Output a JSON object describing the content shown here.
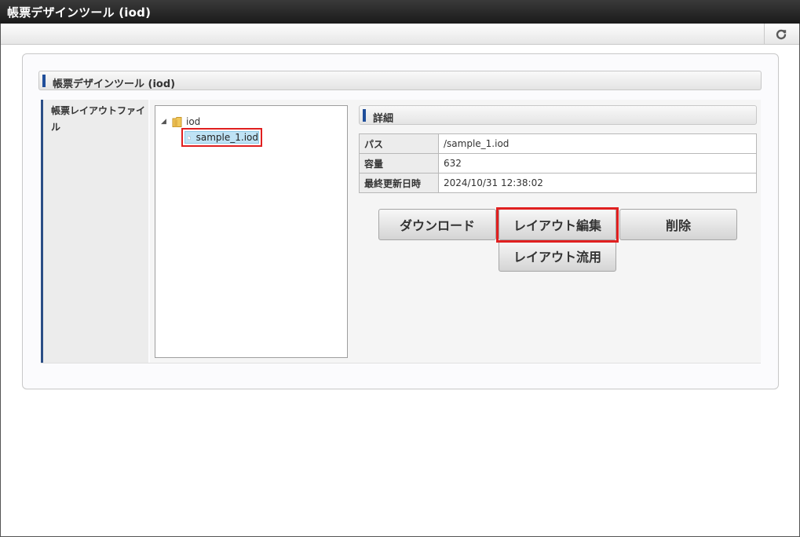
{
  "window": {
    "title": "帳票デザインツール (iod)"
  },
  "toolbar": {
    "refresh_icon": "refresh-icon"
  },
  "panel": {
    "title": "帳票デザインツール (iod)"
  },
  "form": {
    "label": "帳票レイアウトファイル",
    "tree": {
      "root": {
        "label": "iod",
        "icon": "folder-icon",
        "expanded": true
      },
      "children": [
        {
          "label": "sample_1.iod",
          "icon": "file-icon",
          "selected": true
        }
      ]
    },
    "detail": {
      "title": "詳細",
      "rows": [
        {
          "key": "パス",
          "value": "/sample_1.iod"
        },
        {
          "key": "容量",
          "value": "632"
        },
        {
          "key": "最終更新日時",
          "value": "2024/10/31 12:38:02"
        }
      ]
    },
    "buttons": {
      "download": "ダウンロード",
      "edit_layout": "レイアウト編集",
      "delete": "削除",
      "reuse_layout": "レイアウト流用"
    }
  },
  "colors": {
    "accent_bar": "#1f4e9a",
    "highlight": "#e02020",
    "selection": "#bfe3f5"
  }
}
